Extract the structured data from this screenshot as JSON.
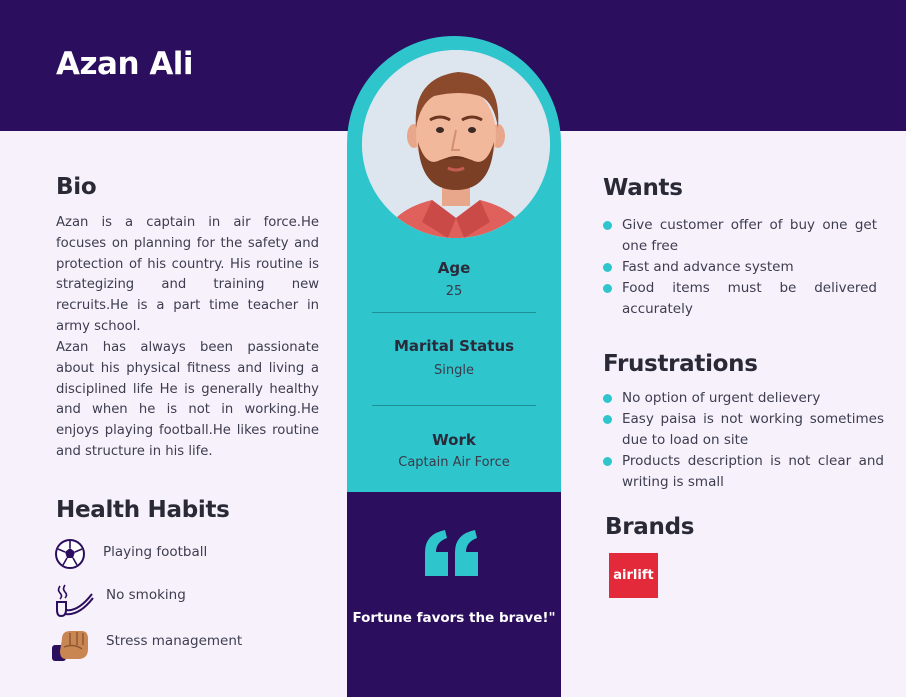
{
  "persona": {
    "name": "Azan Ali"
  },
  "stats": [
    {
      "label": "Age",
      "value": "25"
    },
    {
      "label": "Marital Status",
      "value": "Single"
    },
    {
      "label": "Work",
      "value": "Captain Air Force"
    }
  ],
  "quote": {
    "text": "Fortune favors the brave!\""
  },
  "bio": {
    "title": "Bio",
    "paragraphs": [
      "Azan is a captain in  air force.He focuses on planning for the safety and protection of his country. His routine is strategizing and training new recruits.He is a part time teacher in army school.",
      "Azan has always been passionate about his physical fitness and living a disciplined life He is generally healthy and when he is not in working.He enjoys playing football.He likes routine and structure in his life."
    ]
  },
  "health_habits": {
    "title": "Health Habits",
    "items": [
      {
        "label": "Playing football",
        "icon": "football-icon"
      },
      {
        "label": "No smoking",
        "icon": "pipe-icon"
      },
      {
        "label": "Stress management",
        "icon": "fist-icon"
      }
    ]
  },
  "wants": {
    "title": "Wants",
    "items": [
      "Give customer offer of buy one get one free",
      "Fast and advance system",
      "Food items must be delivered accurately"
    ]
  },
  "frustrations": {
    "title": "Frustrations",
    "items": [
      "No option of urgent delievery",
      "Easy paisa is not working sometimes due to load on site",
      "Products description is not  clear and writing is small"
    ]
  },
  "brands": {
    "title": "Brands",
    "logos": [
      {
        "name": "airlift",
        "color": "#e32a3b"
      }
    ]
  },
  "colors": {
    "navy": "#2b0e5d",
    "teal": "#2ec5cc",
    "background": "#f7f1fb"
  }
}
